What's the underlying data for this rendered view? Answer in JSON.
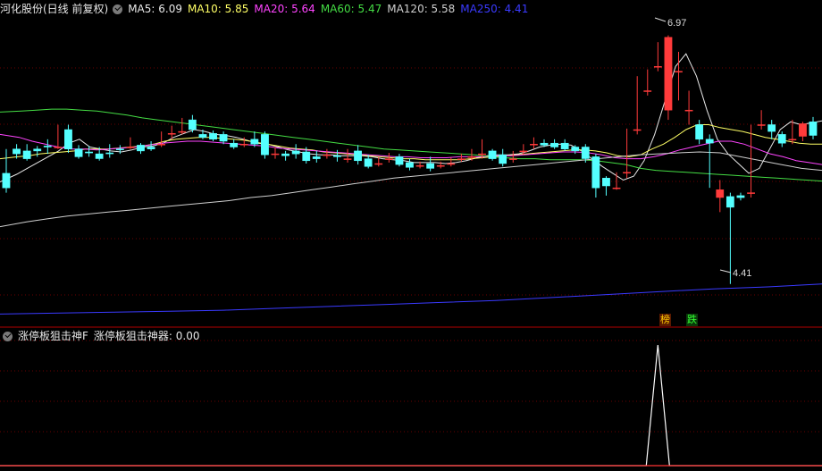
{
  "top_header": {
    "stock_title": "河化股份(日线 前复权)",
    "ma": [
      {
        "label": "MA5: 6.09",
        "color": "#e8e8e8"
      },
      {
        "label": "MA10: 5.85",
        "color": "#ffff66"
      },
      {
        "label": "MA20: 5.64",
        "color": "#ff44ff"
      },
      {
        "label": "MA60: 5.47",
        "color": "#44dd44"
      },
      {
        "label": "MA120: 5.58",
        "color": "#cfcfcf"
      },
      {
        "label": "MA250: 4.41",
        "color": "#3a3aff"
      }
    ]
  },
  "price_annotations": {
    "high": "6.97",
    "low": "4.41"
  },
  "badges": [
    {
      "text": "榜",
      "color": "#ffcc00",
      "bg": "#5a1a00"
    },
    {
      "text": "跌",
      "color": "#33ff33",
      "bg": "#0a3a0a"
    }
  ],
  "indicator_header": {
    "name": "涨停板狙击神F",
    "value_label": "涨停板狙击神器: 0.00"
  },
  "colors": {
    "up": "#ff3b3b",
    "down": "#54ffff",
    "grid": "#7a0000",
    "divider": "#b00000"
  },
  "chart_data": {
    "type": "candlestick",
    "price_range": [
      4.15,
      7.15
    ],
    "candles": [
      [
        5.55,
        5.8,
        5.4,
        5.35
      ],
      [
        5.8,
        5.85,
        5.75,
        5.7
      ],
      [
        5.78,
        5.85,
        5.7,
        5.68
      ],
      [
        5.8,
        5.83,
        5.78,
        5.72
      ],
      [
        5.83,
        5.9,
        5.82,
        5.75
      ],
      [
        5.82,
        6.05,
        5.82,
        5.8
      ],
      [
        6.0,
        6.05,
        5.8,
        5.76
      ],
      [
        5.8,
        5.84,
        5.72,
        5.7
      ],
      [
        5.77,
        5.83,
        5.76,
        5.72
      ],
      [
        5.75,
        5.82,
        5.7,
        5.68
      ],
      [
        5.76,
        5.85,
        5.75,
        5.71
      ],
      [
        5.8,
        5.84,
        5.79,
        5.75
      ],
      [
        5.82,
        5.92,
        5.82,
        5.8
      ],
      [
        5.84,
        5.86,
        5.78,
        5.75
      ],
      [
        5.82,
        5.88,
        5.8,
        5.78
      ],
      [
        5.85,
        5.98,
        5.85,
        5.82
      ],
      [
        5.96,
        6.04,
        5.96,
        5.9
      ],
      [
        5.98,
        6.12,
        5.98,
        5.95
      ],
      [
        6.1,
        6.15,
        6.0,
        5.97
      ],
      [
        5.95,
        6.0,
        5.92,
        5.9
      ],
      [
        5.96,
        5.99,
        5.9,
        5.88
      ],
      [
        5.95,
        5.98,
        5.88,
        5.85
      ],
      [
        5.86,
        5.9,
        5.82,
        5.8
      ],
      [
        5.85,
        5.92,
        5.85,
        5.82
      ],
      [
        5.9,
        5.98,
        5.85,
        5.82
      ],
      [
        5.95,
        5.98,
        5.74,
        5.7
      ],
      [
        5.75,
        5.82,
        5.75,
        5.7
      ],
      [
        5.75,
        5.78,
        5.73,
        5.68
      ],
      [
        5.78,
        5.85,
        5.75,
        5.7
      ],
      [
        5.77,
        5.82,
        5.68,
        5.65
      ],
      [
        5.72,
        5.78,
        5.7,
        5.66
      ],
      [
        5.74,
        5.8,
        5.74,
        5.7
      ],
      [
        5.73,
        5.79,
        5.72,
        5.67
      ],
      [
        5.7,
        5.8,
        5.7,
        5.66
      ],
      [
        5.78,
        5.84,
        5.68,
        5.64
      ],
      [
        5.7,
        5.74,
        5.62,
        5.6
      ],
      [
        5.65,
        5.72,
        5.65,
        5.62
      ],
      [
        5.7,
        5.76,
        5.7,
        5.66
      ],
      [
        5.72,
        5.75,
        5.64,
        5.62
      ],
      [
        5.66,
        5.7,
        5.61,
        5.58
      ],
      [
        5.63,
        5.67,
        5.63,
        5.6
      ],
      [
        5.65,
        5.72,
        5.6,
        5.57
      ],
      [
        5.63,
        5.67,
        5.63,
        5.6
      ],
      [
        5.65,
        5.71,
        5.65,
        5.62
      ],
      [
        5.7,
        5.75,
        5.7,
        5.67
      ],
      [
        5.72,
        5.8,
        5.72,
        5.68
      ],
      [
        5.75,
        5.9,
        5.75,
        5.7
      ],
      [
        5.78,
        5.8,
        5.7,
        5.68
      ],
      [
        5.74,
        5.8,
        5.65,
        5.62
      ],
      [
        5.7,
        5.78,
        5.7,
        5.66
      ],
      [
        5.78,
        5.85,
        5.78,
        5.74
      ],
      [
        5.85,
        5.92,
        5.85,
        5.8
      ],
      [
        5.86,
        5.9,
        5.84,
        5.82
      ],
      [
        5.86,
        5.9,
        5.82,
        5.8
      ],
      [
        5.86,
        5.9,
        5.8,
        5.78
      ],
      [
        5.82,
        5.84,
        5.78,
        5.75
      ],
      [
        5.82,
        5.85,
        5.7,
        5.66
      ],
      [
        5.72,
        5.75,
        5.4,
        5.3
      ],
      [
        5.5,
        5.52,
        5.42,
        5.32
      ],
      [
        5.4,
        5.56,
        5.4,
        5.38
      ],
      [
        5.56,
        6.01,
        5.56,
        5.5
      ],
      [
        6.0,
        6.55,
        6.0,
        5.95
      ],
      [
        6.4,
        6.62,
        6.4,
        6.35
      ],
      [
        6.65,
        6.9,
        6.65,
        6.6
      ],
      [
        6.2,
        6.97,
        6.95,
        6.1
      ],
      [
        6.6,
        6.8,
        6.6,
        6.3
      ],
      [
        6.2,
        6.4,
        6.2,
        6.05
      ],
      [
        6.05,
        6.1,
        5.9,
        5.85
      ],
      [
        5.9,
        5.95,
        5.86,
        5.4
      ],
      [
        5.3,
        5.48,
        5.38,
        5.15
      ],
      [
        5.31,
        5.35,
        5.2,
        4.41
      ],
      [
        5.32,
        5.35,
        5.3,
        5.27
      ],
      [
        5.35,
        6.05,
        5.35,
        5.3
      ],
      [
        6.05,
        6.2,
        6.05,
        6.0
      ],
      [
        6.05,
        6.1,
        5.98,
        5.9
      ],
      [
        5.95,
        5.98,
        5.86,
        5.82
      ],
      [
        5.9,
        6.1,
        5.9,
        5.85
      ],
      [
        5.93,
        6.08,
        6.06,
        5.88
      ],
      [
        6.08,
        6.13,
        5.94,
        5.9
      ]
    ],
    "ma_series": {
      "MA5": [
        5.46,
        5.54,
        5.6,
        5.66,
        5.72,
        5.78,
        5.86,
        5.9,
        5.82,
        5.8,
        5.78,
        5.77,
        5.79,
        5.82,
        5.83,
        5.86,
        5.92,
        5.96,
        6.0,
        5.98,
        5.95,
        5.94,
        5.92,
        5.89,
        5.86,
        5.85,
        5.82,
        5.79,
        5.77,
        5.75,
        5.74,
        5.74,
        5.73,
        5.73,
        5.73,
        5.72,
        5.7,
        5.69,
        5.68,
        5.66,
        5.66,
        5.66,
        5.65,
        5.66,
        5.68,
        5.71,
        5.73,
        5.74,
        5.74,
        5.75,
        5.78,
        5.82,
        5.84,
        5.85,
        5.84,
        5.78,
        5.7,
        5.62,
        5.55,
        5.48,
        5.52,
        5.68,
        5.95,
        6.3,
        6.65,
        6.78,
        6.55,
        6.2,
        5.9,
        5.75,
        5.65,
        5.55,
        5.6,
        5.8,
        6.0,
        6.08,
        6.05,
        6.07,
        6.09
      ],
      "MA10": [
        5.7,
        5.72,
        5.73,
        5.75,
        5.76,
        5.77,
        5.78,
        5.8,
        5.8,
        5.8,
        5.81,
        5.82,
        5.83,
        5.85,
        5.88,
        5.9,
        5.91,
        5.92,
        5.92,
        5.91,
        5.9,
        5.89,
        5.87,
        5.85,
        5.83,
        5.81,
        5.8,
        5.79,
        5.77,
        5.76,
        5.75,
        5.74,
        5.73,
        5.72,
        5.71,
        5.7,
        5.7,
        5.69,
        5.69,
        5.69,
        5.69,
        5.7,
        5.71,
        5.72,
        5.73,
        5.74,
        5.75,
        5.76,
        5.77,
        5.78,
        5.79,
        5.79,
        5.78,
        5.76,
        5.73,
        5.72,
        5.74,
        5.8,
        5.85,
        5.92,
        6.0,
        6.05,
        6.05,
        6.02,
        6.0,
        5.98,
        5.95,
        5.92,
        5.9,
        5.88,
        5.86,
        5.85,
        5.85
      ],
      "MA20": [
        5.95,
        5.92,
        5.88,
        5.85,
        5.82,
        5.8,
        5.8,
        5.79,
        5.8,
        5.81,
        5.82,
        5.84,
        5.86,
        5.87,
        5.88,
        5.88,
        5.87,
        5.86,
        5.85,
        5.84,
        5.83,
        5.81,
        5.8,
        5.79,
        5.78,
        5.77,
        5.76,
        5.75,
        5.74,
        5.73,
        5.72,
        5.72,
        5.71,
        5.71,
        5.71,
        5.72,
        5.72,
        5.72,
        5.73,
        5.73,
        5.74,
        5.75,
        5.76,
        5.77,
        5.77,
        5.76,
        5.74,
        5.71,
        5.7,
        5.7,
        5.72,
        5.75,
        5.79,
        5.82,
        5.85,
        5.88,
        5.88,
        5.85,
        5.8,
        5.75,
        5.72,
        5.68,
        5.66,
        5.64
      ],
      "MA60": [
        6.18,
        6.19,
        6.2,
        6.21,
        6.21,
        6.2,
        6.19,
        6.17,
        6.15,
        6.12,
        6.1,
        6.08,
        6.06,
        6.04,
        6.02,
        6.0,
        5.98,
        5.96,
        5.94,
        5.92,
        5.9,
        5.88,
        5.86,
        5.84,
        5.82,
        5.8,
        5.79,
        5.78,
        5.77,
        5.76,
        5.75,
        5.74,
        5.72,
        5.71,
        5.7,
        5.7,
        5.69,
        5.69,
        5.69,
        5.68,
        5.66,
        5.64,
        5.6,
        5.58,
        5.57,
        5.56,
        5.55,
        5.54,
        5.53,
        5.52,
        5.51,
        5.5,
        5.49,
        5.48,
        5.47
      ],
      "MA120": [
        5.0,
        5.05,
        5.08,
        5.11,
        5.13,
        5.15,
        5.17,
        5.19,
        5.21,
        5.23,
        5.25,
        5.27,
        5.3,
        5.32,
        5.35,
        5.38,
        5.41,
        5.44,
        5.47,
        5.5,
        5.52,
        5.54,
        5.56,
        5.58,
        5.6,
        5.62,
        5.64,
        5.66,
        5.68,
        5.7,
        5.72,
        5.74,
        5.75,
        5.76,
        5.77,
        5.76,
        5.72,
        5.68,
        5.64,
        5.6,
        5.58
      ],
      "MA250": [
        4.1,
        4.11,
        4.12,
        4.13,
        4.14,
        4.16,
        4.18,
        4.2,
        4.22,
        4.24,
        4.27,
        4.3,
        4.33,
        4.36,
        4.38,
        4.41
      ]
    },
    "indicator": {
      "name": "涨停板狙击神器",
      "value": 0.0,
      "signal_index": 63
    }
  }
}
